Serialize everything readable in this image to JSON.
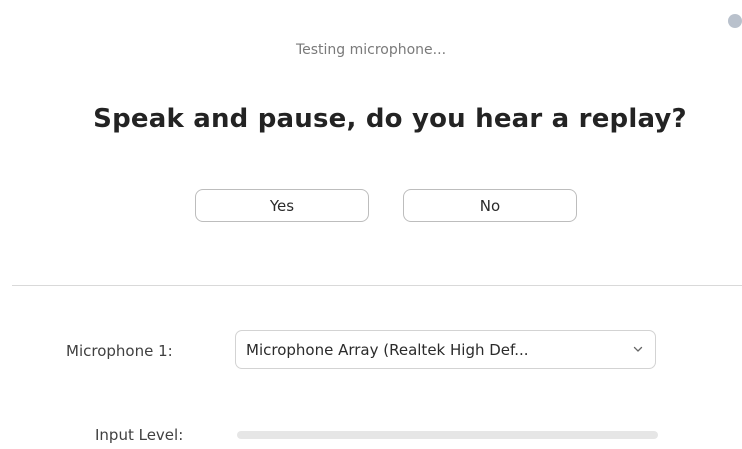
{
  "status": {
    "text": "Testing microphone..."
  },
  "prompt": {
    "title": "Speak and pause, do you hear a replay?"
  },
  "buttons": {
    "yes_label": "Yes",
    "no_label": "No"
  },
  "microphone": {
    "label": "Microphone 1:",
    "selected": "Microphone Array (Realtek High Def..."
  },
  "input_level": {
    "label": "Input Level:",
    "level": 0
  },
  "icons": {
    "corner": "settings-icon",
    "dropdown": "chevron-down-icon"
  },
  "colors": {
    "title_text": "#232323",
    "muted_text": "#7a7a7a",
    "border": "#bdbdbd",
    "meter_track": "#e6e6e6"
  }
}
